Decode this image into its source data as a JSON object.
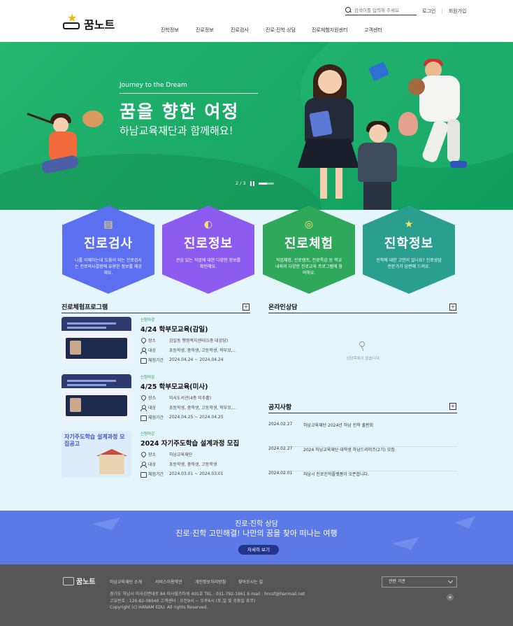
{
  "header": {
    "logo_text": "꿈노트",
    "search_placeholder": "검색어를 입력해 주세요",
    "login": "로그인",
    "signup": "회원가입",
    "nav": [
      "진학정보",
      "진로정보",
      "진로검사",
      "진로·진학 상담",
      "진로체험지원센터",
      "고객센터"
    ]
  },
  "hero": {
    "subtitle": "Journey to the Dream",
    "title": "꿈을 향한 여정",
    "desc": "하남교육재단과 함께해요!",
    "pager": "2 / 3"
  },
  "cards": [
    {
      "title": "진로검사",
      "desc": "나를 이해하는데 도움이 되는 진로검사는 진로의사결정에 유용한 정보를 제공해요.",
      "icon": "clipboard-icon"
    },
    {
      "title": "진로정보",
      "desc": "관심 있는 직업에 대한 다양한 정보를 확인해요.",
      "icon": "satellite-icon"
    },
    {
      "title": "진로체험",
      "desc": "직업체험, 진로캠프, 진로특강 등 학교 내외의 다양한 진로교육 프로그램에 참여해요.",
      "icon": "compass-icon"
    },
    {
      "title": "진학정보",
      "desc": "진학에 대한 고민이 있나요? 진로상담 전문가가 답변해 드려요.",
      "icon": "star-icon"
    }
  ],
  "programs": {
    "title": "진로체험프로그램",
    "place_label": "장소",
    "target_label": "대상",
    "period_label": "체험기간",
    "items": [
      {
        "tag": "신청마감",
        "title": "4/24 학부모교육(감일)",
        "place": "감일동 행정복지센터(5층 대강당)",
        "target": "초등학생, 중학생, 고등학생, 학부모,…",
        "period": "2024.04.24 ~ 2024.04.24"
      },
      {
        "tag": "신청마감",
        "title": "4/25 학부모교육(미사)",
        "place": "미사도서관(4층 미추홀)",
        "target": "초등학생, 중학생, 고등학생, 학부모,…",
        "period": "2024.04.25 ~ 2024.04.25"
      },
      {
        "tag": "신청마감",
        "title": "2024 자기주도학습 설계과정 모집",
        "place": "하남교육재단",
        "target": "초등학생, 중학생, 고등학생",
        "period": "2024.03.01 ~ 2024.03.01",
        "thumb_text": "자기주도학습 설계과정 모집공고"
      }
    ]
  },
  "consult": {
    "title": "온라인상담",
    "empty": "상담목록이 없습니다."
  },
  "notice": {
    "title": "공지사항",
    "items": [
      {
        "date": "2024.02.27",
        "text": "하남교육재단 2024년 하남 진학 출판회"
      },
      {
        "date": "2024.02.27",
        "text": "2024 하남교육재단 대학생 하남드리머즈(2기) 모집"
      },
      {
        "date": "2024.02.01",
        "text": "하남시 진로진학플랫폼이 오픈합니다."
      }
    ]
  },
  "banner": {
    "title": "진로·진학 상담",
    "subtitle": "진로·진학 고민해결! 나만의 꿈을 찾아 떠나는 여행",
    "button": "자세히 보기"
  },
  "footer": {
    "logo_text": "꿈노트",
    "links": [
      "하남교육재단 소개",
      "서비스이용약관",
      "개인정보처리방침",
      "찾아오시는 길"
    ],
    "select": "관련 기관",
    "address": "경기도 하남시 미사강변대로 84 미사힐즈타워 401호   TEL : 031-792-1661   E-mail : hncsf@hanmail.net",
    "biz": "고유번호 : 126-82-08940   고객센터 : 오전9시 ~ 오후6시 (토,일 및 공휴일 휴무)",
    "copyright": "Copyright (c) HANAM EDU. All rights Reserved."
  }
}
